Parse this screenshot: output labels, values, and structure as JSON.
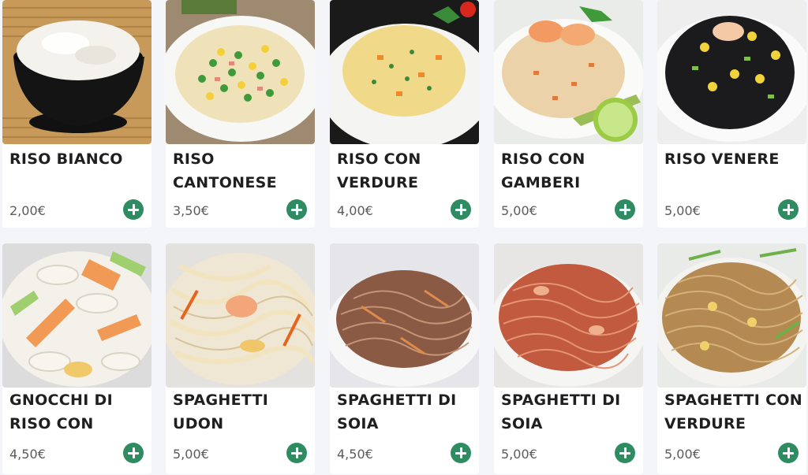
{
  "menu": {
    "items": [
      {
        "name": "RISO BIANCO",
        "price": "2,00€",
        "image": "white-rice-bowl"
      },
      {
        "name": "RISO CANTONESE",
        "price": "3,50€",
        "image": "cantonese-rice-plate"
      },
      {
        "name": "RISO CON VERDURE",
        "price": "4,00€",
        "image": "vegetable-rice-plate"
      },
      {
        "name": "RISO CON GAMBERI",
        "price": "5,00€",
        "image": "shrimp-rice-plate"
      },
      {
        "name": "RISO VENERE",
        "price": "5,00€",
        "image": "black-rice-plate"
      },
      {
        "name": "GNOCCHI DI RISO CON",
        "price": "4,50€",
        "image": "rice-gnocchi-vegetables"
      },
      {
        "name": "SPAGHETTI UDON",
        "price": "5,00€",
        "image": "udon-noodles"
      },
      {
        "name": "SPAGHETTI DI SOIA",
        "price": "4,50€",
        "image": "soy-noodles"
      },
      {
        "name": "SPAGHETTI DI SOIA",
        "price": "5,00€",
        "image": "soy-noodles-red"
      },
      {
        "name": "SPAGHETTI CON VERDURE",
        "price": "5,00€",
        "image": "spaghetti-vegetables"
      }
    ]
  },
  "icons": {
    "add": "plus-circle-icon"
  },
  "colors": {
    "add_button": "#2e8b62",
    "background": "#f3f5f8",
    "card": "#ffffff",
    "title": "#1f1f1f",
    "price": "#5b5b5b"
  }
}
